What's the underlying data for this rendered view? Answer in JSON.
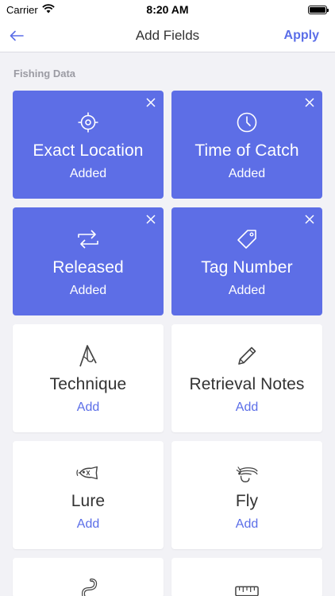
{
  "status_bar": {
    "carrier": "Carrier",
    "time": "8:20 AM"
  },
  "nav": {
    "title": "Add Fields",
    "apply_label": "Apply"
  },
  "section": {
    "label": "Fishing Data"
  },
  "cards": [
    {
      "label": "Exact Location",
      "status": "Added",
      "icon": "crosshair-icon",
      "added": true
    },
    {
      "label": "Time of Catch",
      "status": "Added",
      "icon": "clock-icon",
      "added": true
    },
    {
      "label": "Released",
      "status": "Added",
      "icon": "release-arrows-icon",
      "added": true
    },
    {
      "label": "Tag Number",
      "status": "Added",
      "icon": "tag-icon",
      "added": true
    },
    {
      "label": "Technique",
      "status": "Add",
      "icon": "fishing-rod-icon",
      "added": false
    },
    {
      "label": "Retrieval Notes",
      "status": "Add",
      "icon": "pencil-icon",
      "added": false
    },
    {
      "label": "Lure",
      "status": "Add",
      "icon": "lure-icon",
      "added": false
    },
    {
      "label": "Fly",
      "status": "Add",
      "icon": "fly-icon",
      "added": false
    }
  ],
  "colors": {
    "accent": "#5d6ee6",
    "background": "#f2f2f6",
    "card": "#ffffff"
  }
}
